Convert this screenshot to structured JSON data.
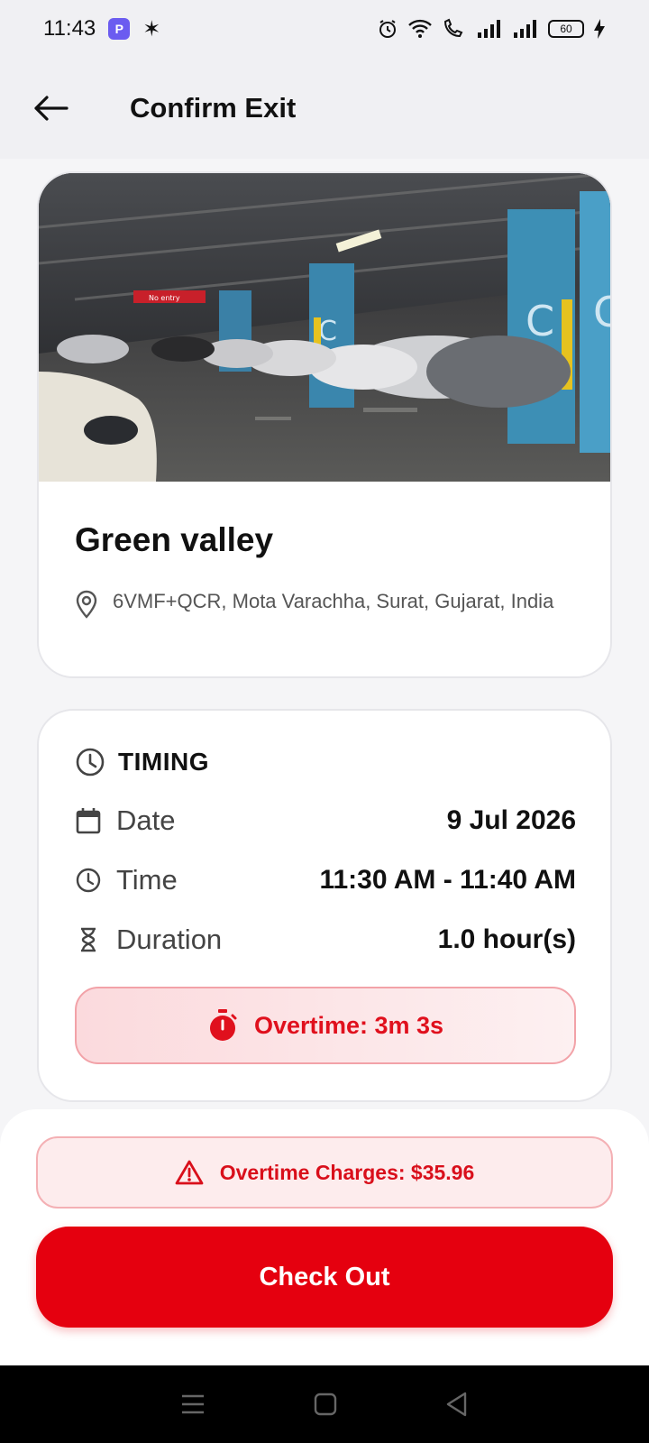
{
  "status_bar": {
    "time": "11:43",
    "battery": "60"
  },
  "app_bar": {
    "title": "Confirm Exit"
  },
  "place": {
    "name": "Green valley",
    "address": "6VMF+QCR, Mota Varachha, Surat, Gujarat, India",
    "photo_sign": "No entry"
  },
  "timing": {
    "heading": "TIMING",
    "rows": [
      {
        "label": "Date",
        "value": "9 Jul 2026",
        "icon": "calendar-icon"
      },
      {
        "label": "Time",
        "value": "11:30 AM - 11:40 AM",
        "icon": "clock-icon"
      },
      {
        "label": "Duration",
        "value": "1.0 hour(s)",
        "icon": "hourglass-icon"
      }
    ],
    "overtime": "Overtime: 3m 3s"
  },
  "charges": {
    "text": "Overtime Charges: $35.96"
  },
  "checkout": {
    "label": "Check Out"
  },
  "colors": {
    "accent": "#e5000f",
    "alert_bg": "#fdeced",
    "alert_text": "#d90f1b"
  }
}
